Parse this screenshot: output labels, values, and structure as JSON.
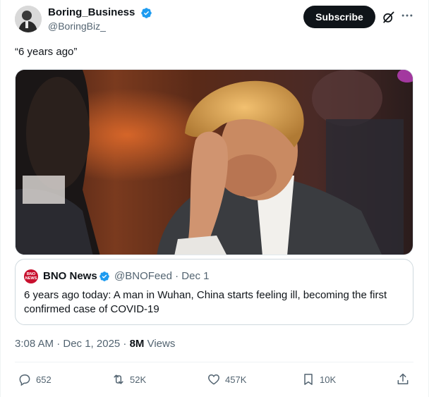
{
  "author": {
    "display_name": "Boring_Business",
    "handle": "@BoringBiz_"
  },
  "header": {
    "subscribe_label": "Subscribe"
  },
  "tweet": {
    "text": "“6 years ago”"
  },
  "quote": {
    "logo_text": "BNO NEWS",
    "name": "BNO News",
    "handle": "@BNOFeed",
    "separator": "·",
    "date": "Dec 1",
    "text": "6 years ago today: A man in Wuhan, China starts feeling ill, becoming the first confirmed case of COVID-19"
  },
  "meta": {
    "time": "3:08 AM · Dec 1, 2025 · ",
    "views_count": "8M",
    "views_label": " Views"
  },
  "actions": {
    "replies": "652",
    "reposts": "52K",
    "likes": "457K",
    "bookmarks": "10K"
  },
  "icons": {
    "verified": "verified-badge-icon",
    "grok": "grok-icon",
    "more": "more-horizontal-icon",
    "reply": "reply-icon",
    "retweet": "retweet-icon",
    "like": "heart-icon",
    "bookmark": "bookmark-icon",
    "share": "share-icon"
  },
  "colors": {
    "verified": "#1d9bf0",
    "text_secondary": "#536471",
    "subscribe_bg": "#0f1419",
    "bno_red": "#c8102e"
  }
}
